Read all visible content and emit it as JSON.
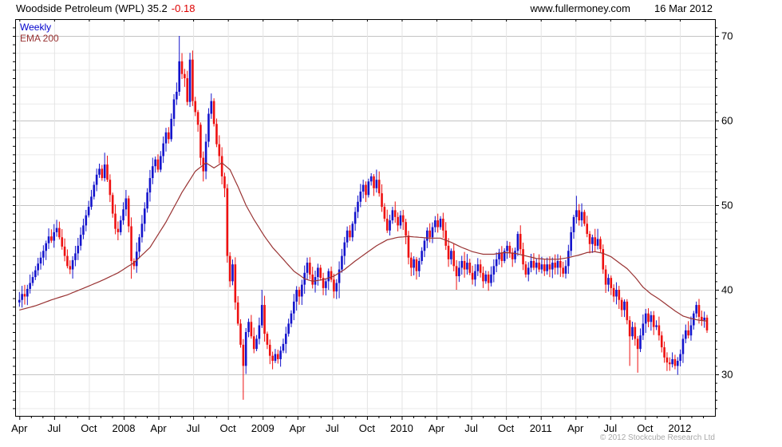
{
  "header": {
    "title": "Woodside Petroleum (WPL) 35.2",
    "change": "-0.18",
    "site": "www.fullermoney.com",
    "date": "16 Mar 2012"
  },
  "legend": {
    "series_label": "Weekly",
    "overlay_label": "EMA 200"
  },
  "footer": {
    "copyright": "© 2012 Stockcube Research Ltd"
  },
  "colors": {
    "up_candle": "#1414cc",
    "down_candle": "#ee1111",
    "ema_line": "#993333",
    "grid_minor": "#eaeaea",
    "grid_major": "#c4c4c4",
    "grid_vertical": "#e4e4e4",
    "axis": "#000000",
    "change_text": "#dd0000",
    "copyright_text": "#a9a9a9"
  },
  "chart_data": {
    "type": "candlestick",
    "interval": "weekly",
    "instrument": "Woodside Petroleum (WPL)",
    "last_price": 35.2,
    "change": -0.18,
    "legend": [
      "Weekly",
      "EMA 200"
    ],
    "ylim": [
      25.1,
      72.0
    ],
    "grid": "on",
    "x_axis": {
      "start": "Apr 2007",
      "end": "Mar 2012",
      "labels": [
        "Apr",
        "Jul",
        "Oct",
        "2008",
        "Apr",
        "Jul",
        "Oct",
        "2009",
        "Apr",
        "Jul",
        "Oct",
        "2010",
        "Apr",
        "Jul",
        "Oct",
        "2011",
        "Apr",
        "Jul",
        "Oct",
        "2012"
      ]
    },
    "y_axis": {
      "labels": [
        "70",
        "60",
        "50",
        "40",
        "30"
      ],
      "values": [
        70,
        60,
        50,
        40,
        30
      ],
      "minor_step": 1,
      "grid_step": 2
    },
    "first_open": 38.5,
    "closes": [
      38.8,
      39.5,
      39.2,
      40.1,
      40.8,
      41.5,
      42.3,
      43.1,
      43.8,
      44.6,
      45.5,
      46.3,
      45.8,
      46.8,
      47.3,
      46.2,
      45.1,
      44.0,
      42.8,
      42.4,
      43.5,
      44.3,
      45.2,
      46.5,
      47.6,
      48.8,
      49.8,
      51.0,
      52.4,
      53.6,
      54.3,
      53.2,
      54.8,
      53.0,
      51.2,
      49.0,
      47.2,
      46.8,
      48.2,
      49.5,
      50.8,
      47.5,
      43.4,
      42.8,
      44.5,
      46.2,
      47.8,
      49.6,
      51.5,
      53.2,
      54.6,
      55.4,
      54.2,
      55.8,
      57.3,
      58.6,
      57.8,
      60.2,
      62.5,
      63.4,
      67.0,
      65.5,
      65.0,
      62.2,
      67.2,
      62.3,
      61.0,
      59.5,
      55.6,
      54.0,
      57.5,
      60.8,
      62.3,
      59.6,
      57.2,
      55.8,
      53.4,
      52.0,
      44.0,
      41.0,
      43.0,
      38.5,
      36.0,
      33.5,
      31.0,
      35.0,
      36.2,
      34.5,
      33.0,
      34.2,
      35.8,
      38.2,
      34.8,
      33.5,
      32.2,
      31.6,
      32.4,
      31.8,
      32.8,
      33.6,
      34.8,
      36.0,
      37.2,
      38.6,
      40.0,
      39.2,
      40.6,
      42.0,
      43.2,
      41.8,
      40.6,
      41.5,
      42.6,
      41.4,
      40.2,
      41.0,
      42.2,
      41.2,
      39.8,
      40.8,
      42.4,
      44.0,
      45.6,
      47.0,
      46.2,
      47.8,
      49.2,
      50.4,
      51.6,
      52.4,
      51.2,
      52.8,
      53.4,
      52.0,
      53.0,
      51.4,
      49.8,
      48.4,
      47.0,
      48.2,
      49.4,
      48.6,
      47.6,
      48.8,
      48.0,
      46.4,
      43.8,
      42.6,
      43.6,
      42.2,
      43.4,
      44.6,
      45.8,
      47.0,
      46.2,
      47.4,
      48.2,
      47.4,
      48.4,
      47.0,
      45.2,
      43.6,
      44.6,
      42.8,
      41.6,
      42.6,
      43.4,
      42.4,
      43.2,
      42.0,
      41.2,
      42.2,
      43.0,
      42.0,
      41.0,
      41.8,
      40.8,
      41.8,
      42.8,
      43.6,
      44.4,
      43.4,
      44.6,
      45.2,
      44.4,
      43.6,
      44.6,
      46.6,
      44.8,
      43.0,
      41.8,
      42.6,
      43.4,
      42.6,
      43.2,
      42.4,
      43.0,
      42.2,
      43.0,
      42.4,
      43.2,
      42.6,
      43.4,
      42.6,
      41.9,
      42.8,
      44.6,
      46.8,
      48.6,
      49.4,
      48.2,
      49.2,
      47.8,
      46.6,
      45.4,
      46.2,
      45.2,
      46.0,
      44.8,
      42.4,
      40.6,
      41.4,
      40.2,
      39.2,
      40.0,
      38.8,
      37.6,
      38.6,
      36.4,
      34.5,
      35.6,
      34.2,
      33.0,
      34.6,
      36.0,
      37.2,
      36.2,
      37.0,
      35.6,
      35.8,
      34.6,
      33.2,
      32.0,
      31.4,
      31.2,
      31.8,
      31.0,
      31.6,
      32.4,
      34.2,
      35.2,
      34.6,
      35.8,
      37.2,
      38.2,
      36.8,
      36.4,
      36.7,
      35.2
    ],
    "wick_overrides": {
      "0": {
        "l": 38.0
      },
      "32": {
        "h": 56.2
      },
      "42": {
        "l": 41.3
      },
      "60": {
        "h": 70.0
      },
      "64": {
        "h": 68.0
      },
      "69": {
        "l": 52.8
      },
      "72": {
        "h": 63.2
      },
      "78": {
        "l": 43.2
      },
      "84": {
        "l": 27.0
      },
      "91": {
        "h": 40.0
      },
      "95": {
        "l": 30.6
      },
      "108": {
        "h": 43.8
      },
      "120": {
        "l": 39.0
      },
      "134": {
        "h": 54.2
      },
      "146": {
        "l": 43.0
      },
      "149": {
        "l": 41.2
      },
      "158": {
        "h": 48.7
      },
      "164": {
        "l": 40.0
      },
      "187": {
        "h": 46.9
      },
      "209": {
        "h": 51.1
      },
      "217": {
        "h": 47.2
      },
      "229": {
        "l": 31.0
      },
      "232": {
        "l": 30.2
      },
      "243": {
        "l": 30.4
      },
      "246": {
        "l": 30.6
      },
      "254": {
        "h": 38.6
      },
      "258": {
        "l": 34.9
      }
    },
    "ema_anchors": [
      [
        0,
        37.6
      ],
      [
        6,
        38.1
      ],
      [
        12,
        38.8
      ],
      [
        18,
        39.4
      ],
      [
        25,
        40.3
      ],
      [
        31,
        41.1
      ],
      [
        37,
        42.0
      ],
      [
        43,
        43.2
      ],
      [
        49,
        45.0
      ],
      [
        55,
        48.0
      ],
      [
        61,
        51.5
      ],
      [
        66,
        54.0
      ],
      [
        70,
        55.0
      ],
      [
        73,
        54.4
      ],
      [
        76,
        55.0
      ],
      [
        79,
        54.2
      ],
      [
        82,
        52.2
      ],
      [
        85,
        50.0
      ],
      [
        88,
        48.3
      ],
      [
        92,
        46.3
      ],
      [
        95,
        45.0
      ],
      [
        99,
        43.6
      ],
      [
        103,
        42.2
      ],
      [
        107,
        41.3
      ],
      [
        110,
        41.0
      ],
      [
        114,
        41.2
      ],
      [
        118,
        41.6
      ],
      [
        122,
        42.4
      ],
      [
        126,
        43.4
      ],
      [
        130,
        44.3
      ],
      [
        134,
        45.2
      ],
      [
        138,
        45.9
      ],
      [
        142,
        46.2
      ],
      [
        146,
        46.3
      ],
      [
        150,
        46.2
      ],
      [
        154,
        46.1
      ],
      [
        158,
        46.1
      ],
      [
        162,
        45.6
      ],
      [
        166,
        45.0
      ],
      [
        170,
        44.5
      ],
      [
        174,
        44.2
      ],
      [
        178,
        44.2
      ],
      [
        182,
        44.4
      ],
      [
        186,
        44.3
      ],
      [
        190,
        44.0
      ],
      [
        194,
        43.7
      ],
      [
        198,
        43.6
      ],
      [
        202,
        43.6
      ],
      [
        206,
        43.8
      ],
      [
        210,
        44.1
      ],
      [
        213,
        44.4
      ],
      [
        216,
        44.5
      ],
      [
        219,
        44.3
      ],
      [
        222,
        43.9
      ],
      [
        225,
        43.2
      ],
      [
        228,
        42.5
      ],
      [
        231,
        41.5
      ],
      [
        234,
        40.3
      ],
      [
        237,
        39.5
      ],
      [
        240,
        38.9
      ],
      [
        243,
        38.2
      ],
      [
        246,
        37.5
      ],
      [
        249,
        36.9
      ],
      [
        252,
        36.6
      ],
      [
        255,
        36.4
      ],
      [
        258,
        36.3
      ]
    ]
  }
}
